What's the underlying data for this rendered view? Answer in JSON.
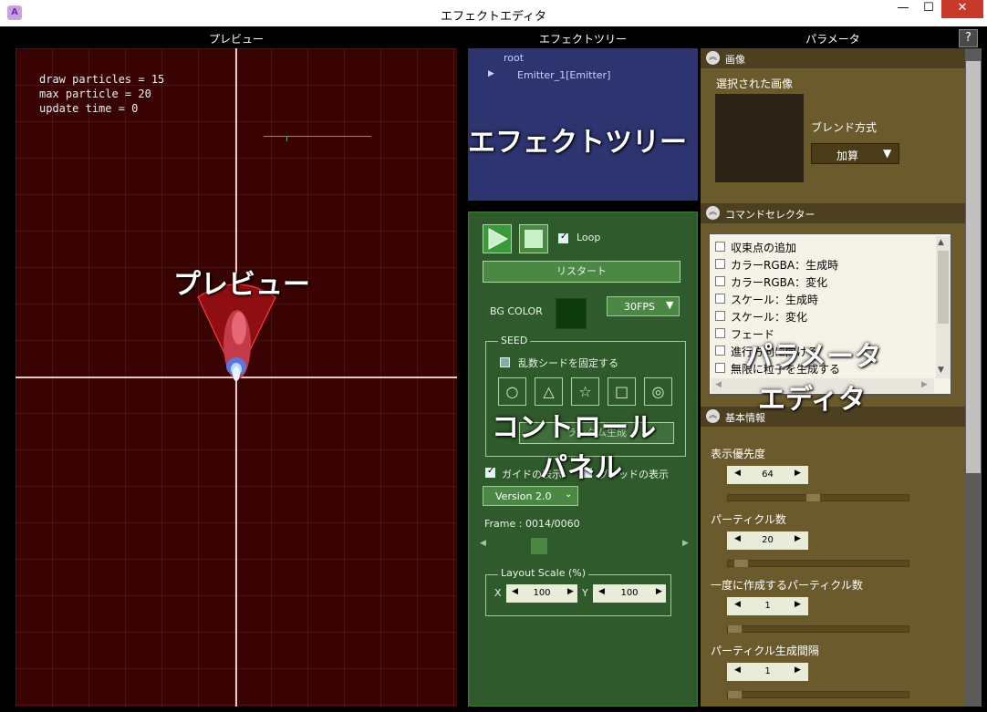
{
  "window": {
    "title": "エフェクトエディタ",
    "app_icon": "A",
    "minimize": "—",
    "maximize": "☐",
    "close": "✕"
  },
  "headers": {
    "preview": "プレビュー",
    "tree": "エフェクトツリー",
    "params": "パラメータ",
    "help": "?"
  },
  "preview": {
    "stats": [
      "draw particles = 15",
      "max particle = 20",
      "update time = 0"
    ],
    "overlay_label": "プレビュー",
    "background_color": "#3a0303"
  },
  "tree": {
    "root": "root",
    "emitter": "Emitter_1[Emitter]",
    "expand_icon": "▶",
    "overlay_label": "エフェクトツリー"
  },
  "control": {
    "loop_label": "Loop",
    "restart_label": "リスタート",
    "bg_color_label": "BG COLOR",
    "fps_value": "30FPS",
    "seed_label": "SEED",
    "fix_seed_label": "乱数シードを固定する",
    "shapes": [
      "○",
      "△",
      "☆",
      "□",
      "◎"
    ],
    "random_gen_label": "ランダム生成",
    "guide_show_label": "ガイドの表示",
    "grid_show_label": "グリッドの表示",
    "version_value": "Version 2.0",
    "frame_text": "Frame : 0014/0060",
    "frame_progress": 0.23,
    "layout_scale_label": "Layout Scale (%)",
    "x_label": "X",
    "y_label": "Y",
    "scale_x": "100",
    "scale_y": "100",
    "overlay_label_1": "コントロール",
    "overlay_label_2": "パネル"
  },
  "params": {
    "image_section": "画像",
    "selected_image_label": "選択された画像",
    "blend_label": "ブレンド方式",
    "blend_value": "加算",
    "command_section": "コマンドセレクター",
    "commands": [
      "収束点の追加",
      "カラーRGBA：生成時",
      "カラーRGBA：変化",
      "スケール：生成時",
      "スケール：変化",
      "フェード",
      "進行方向に向ける",
      "無限に粒子を生成する"
    ],
    "basic_section": "基本情報",
    "fields": [
      {
        "label": "表示優先度",
        "value": "64",
        "slider": 0.47
      },
      {
        "label": "パーティクル数",
        "value": "20",
        "slider": 0.04
      },
      {
        "label": "一度に作成するパーティクル数",
        "value": "1",
        "slider": 0.0
      },
      {
        "label": "パーティクル生成間隔",
        "value": "1",
        "slider": 0.0
      }
    ],
    "overlay_label_1": "パラメータ",
    "overlay_label_2": "エディタ"
  }
}
